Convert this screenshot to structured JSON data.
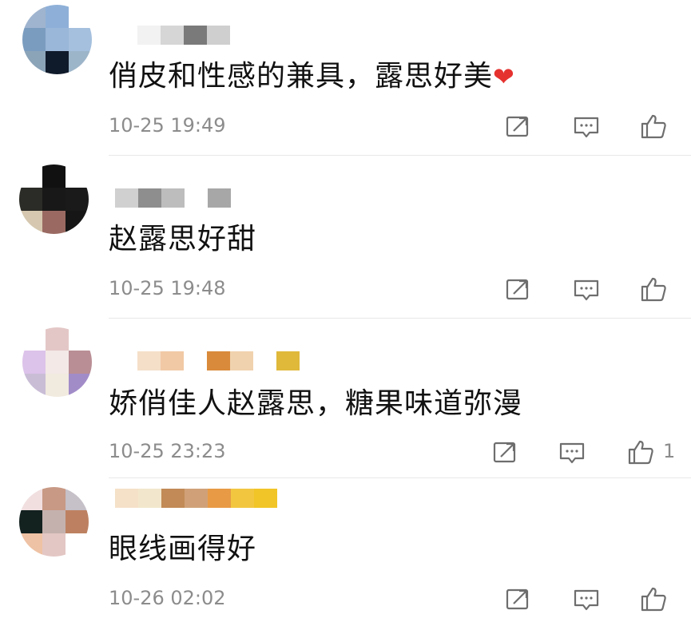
{
  "comments": [
    {
      "text": "俏皮和性感的兼具，露思好美",
      "emoji": "❤",
      "time": "10-25 19:49",
      "likes": "",
      "avatar_colors": [
        "#9fb4cf",
        "#8eb0d8",
        "#ffffff",
        "#7a9cbf",
        "#9ab6d8",
        "#a5c0de",
        "#8ca4b8",
        "#0f1a2a",
        "#9db5c9"
      ],
      "name_colors": [
        "#f2f2f2",
        "#d6d6d6",
        "#7a7a7a",
        "#cfcfcf"
      ]
    },
    {
      "text": "赵露思好甜",
      "emoji": "",
      "time": "10-25 19:48",
      "likes": "",
      "avatar_colors": [
        "#ffffff",
        "#111111",
        "#ffffff",
        "#2b2b27",
        "#181818",
        "#1a1a1a",
        "#d6c8b0",
        "#9a6a62",
        "#161616"
      ],
      "name_colors": [
        "#d0d0d0",
        "#8e8e8e",
        "#bdbdbd",
        "#ffffff",
        "#a7a7a7"
      ]
    },
    {
      "text": "娇俏佳人赵露思，糖果味道弥漫",
      "emoji": "",
      "time": "10-25 23:23",
      "likes": "1",
      "avatar_colors": [
        "#ffffff",
        "#e3c7c6",
        "#ffffff",
        "#dcc3ea",
        "#f3e9e6",
        "#b98e94",
        "#c9bdd6",
        "#f1eadf",
        "#a28cc8"
      ],
      "name_colors": [
        "#f5dfc8",
        "#f1c9a5",
        "#ffffff",
        "#d98a3a",
        "#f0d2ae",
        "#ffffff",
        "#e0b93b"
      ]
    },
    {
      "text": "眼线画得好",
      "emoji": "",
      "time": "10-26 02:02",
      "likes": "",
      "avatar_colors": [
        "#f1dfe0",
        "#c89985",
        "#c6c0c8",
        "#13211f",
        "#c4b1ae",
        "#bd8161",
        "#eec2a4",
        "#e3c7c4",
        "#ffffff"
      ],
      "name_colors": [
        "#f5e1c8",
        "#f2e7cc",
        "#c28a56",
        "#d0a178",
        "#e89a45",
        "#f3c640",
        "#f1c527"
      ]
    }
  ],
  "icons": {
    "share": "share-icon",
    "reply": "comment-icon",
    "like": "thumbs-up-icon"
  }
}
